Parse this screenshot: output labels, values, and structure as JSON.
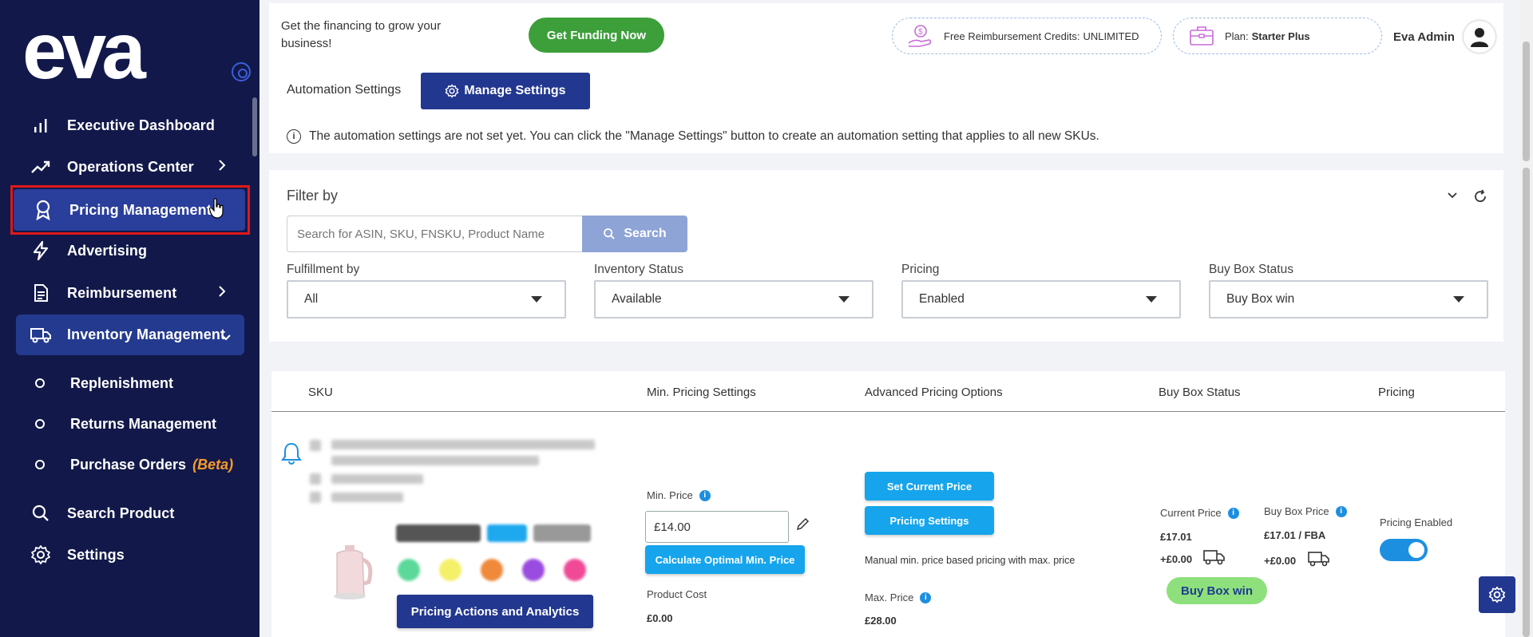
{
  "sidebar": {
    "logo_text": "eva",
    "items": [
      {
        "label": "Executive Dashboard",
        "icon": "bar-chart-icon"
      },
      {
        "label": "Operations Center",
        "icon": "trend-up-icon"
      },
      {
        "label": "Pricing Management",
        "icon": "award-icon"
      },
      {
        "label": "Advertising",
        "icon": "lightning-icon"
      },
      {
        "label": "Reimbursement",
        "icon": "document-icon"
      },
      {
        "label": "Inventory Management",
        "icon": "truck-icon"
      }
    ],
    "sub_items": [
      {
        "label": "Replenishment"
      },
      {
        "label": "Returns Management"
      },
      {
        "label": "Purchase Orders",
        "badge": "(Beta)"
      }
    ],
    "bottom_items": [
      {
        "label": "Search Product",
        "icon": "search-icon"
      },
      {
        "label": "Settings",
        "icon": "gear-icon"
      }
    ]
  },
  "topbar": {
    "financing_text": "Get the financing to grow your business!",
    "funding_button": "Get Funding Now",
    "reimbursement_label": "Free Reimbursement Credits:",
    "reimbursement_value": "UNLIMITED",
    "plan_label": "Plan:",
    "plan_value": "Starter Plus",
    "user_name": "Eva Admin"
  },
  "automation": {
    "label": "Automation Settings",
    "manage_button": "Manage Settings",
    "note": "The automation settings are not set yet. You can click the \"Manage Settings\" button to create an automation setting that applies to all new SKUs."
  },
  "filter": {
    "title": "Filter by",
    "search_placeholder": "Search for ASIN, SKU, FNSKU, Product Name",
    "search_button": "Search",
    "fields": [
      {
        "label": "Fulfillment by",
        "value": "All"
      },
      {
        "label": "Inventory Status",
        "value": "Available"
      },
      {
        "label": "Pricing",
        "value": "Enabled"
      },
      {
        "label": "Buy Box Status",
        "value": "Buy Box win"
      }
    ]
  },
  "table": {
    "headers": [
      "SKU",
      "Min. Pricing Settings",
      "Advanced Pricing Options",
      "Buy Box Status",
      "Pricing"
    ],
    "row": {
      "actions_button": "Pricing Actions and Analytics",
      "min_price_label": "Min. Price",
      "min_price_value": "£14.00",
      "calc_button": "Calculate Optimal Min. Price",
      "product_cost_label": "Product Cost",
      "product_cost_value": "£0.00",
      "set_price_button": "Set Current Price",
      "pricing_settings_button": "Pricing Settings",
      "strategy_note": "Manual min. price based pricing with max. price",
      "max_price_label": "Max. Price",
      "max_price_value": "£28.00",
      "current_price_label": "Current Price",
      "current_price_value": "£17.01",
      "current_price_ship": "+£0.00",
      "buybox_price_label": "Buy Box Price",
      "buybox_price_value": "£17.01 / FBA",
      "buybox_price_ship": "+£0.00",
      "buybox_status": "Buy Box win",
      "pricing_enabled_label": "Pricing Enabled",
      "pricing_enabled": true
    }
  },
  "colors": {
    "sidebar_bg": "#12194a",
    "primary": "#22378f",
    "accent_blue": "#16a5ec",
    "funding_green": "#3c9f3a",
    "highlight_red": "#e01818"
  }
}
